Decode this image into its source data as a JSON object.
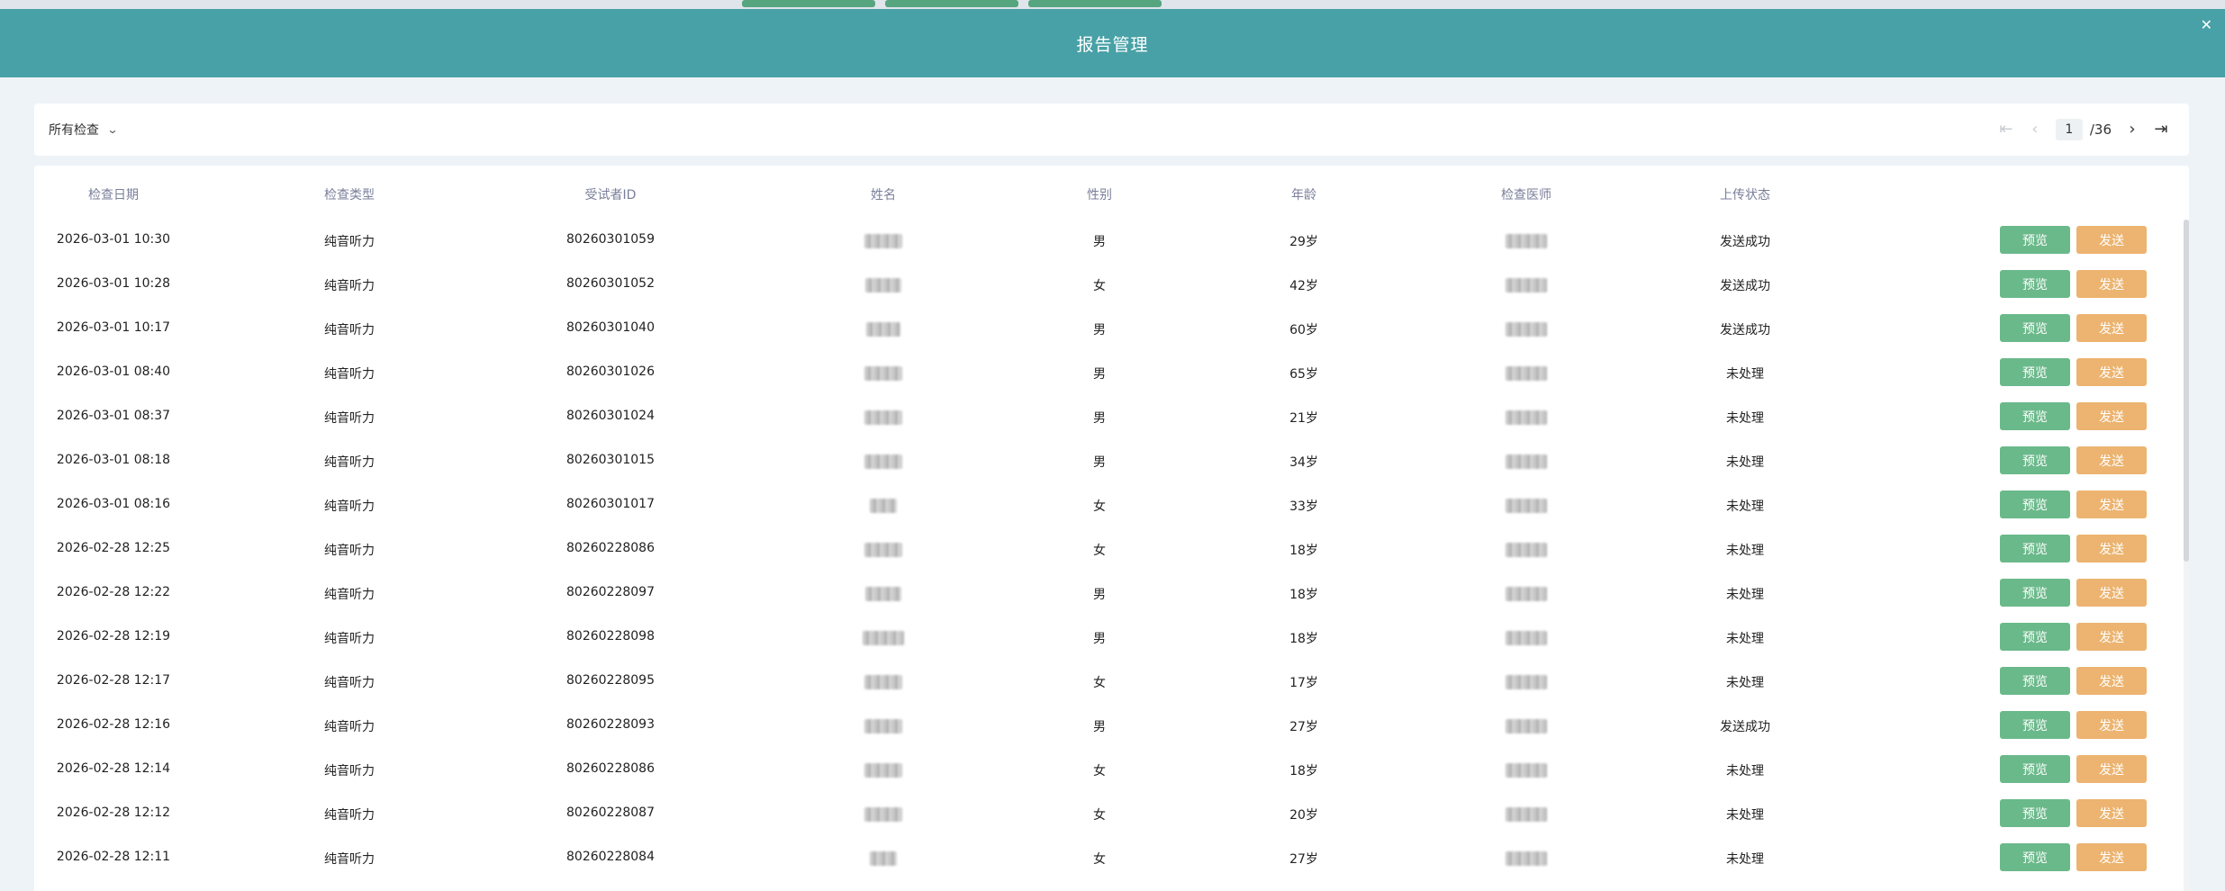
{
  "dialog": {
    "title": "报告管理"
  },
  "toolbar": {
    "filter_label": "所有检查",
    "pager": {
      "current": "1",
      "total": "/36"
    }
  },
  "table": {
    "headers": [
      "检查日期",
      "检查类型",
      "受试者ID",
      "姓名",
      "性别",
      "年龄",
      "检查医师",
      "上传状态"
    ],
    "action_labels": {
      "preview": "预览",
      "send": "发送"
    },
    "rows": [
      {
        "date": "2026-03-01 10:30",
        "type": "纯音听力",
        "id": "80260301059",
        "gender": "男",
        "age": "29岁",
        "status": "发送成功"
      },
      {
        "date": "2026-03-01 10:28",
        "type": "纯音听力",
        "id": "80260301052",
        "gender": "女",
        "age": "42岁",
        "status": "发送成功"
      },
      {
        "date": "2026-03-01 10:17",
        "type": "纯音听力",
        "id": "80260301040",
        "gender": "男",
        "age": "60岁",
        "status": "发送成功"
      },
      {
        "date": "2026-03-01 08:40",
        "type": "纯音听力",
        "id": "80260301026",
        "gender": "男",
        "age": "65岁",
        "status": "未处理"
      },
      {
        "date": "2026-03-01 08:37",
        "type": "纯音听力",
        "id": "80260301024",
        "gender": "男",
        "age": "21岁",
        "status": "未处理"
      },
      {
        "date": "2026-03-01 08:18",
        "type": "纯音听力",
        "id": "80260301015",
        "gender": "男",
        "age": "34岁",
        "status": "未处理"
      },
      {
        "date": "2026-03-01 08:16",
        "type": "纯音听力",
        "id": "80260301017",
        "gender": "女",
        "age": "33岁",
        "status": "未处理"
      },
      {
        "date": "2026-02-28 12:25",
        "type": "纯音听力",
        "id": "80260228086",
        "gender": "女",
        "age": "18岁",
        "status": "未处理"
      },
      {
        "date": "2026-02-28 12:22",
        "type": "纯音听力",
        "id": "80260228097",
        "gender": "男",
        "age": "18岁",
        "status": "未处理"
      },
      {
        "date": "2026-02-28 12:19",
        "type": "纯音听力",
        "id": "80260228098",
        "gender": "男",
        "age": "18岁",
        "status": "未处理"
      },
      {
        "date": "2026-02-28 12:17",
        "type": "纯音听力",
        "id": "80260228095",
        "gender": "女",
        "age": "17岁",
        "status": "未处理"
      },
      {
        "date": "2026-02-28 12:16",
        "type": "纯音听力",
        "id": "80260228093",
        "gender": "男",
        "age": "27岁",
        "status": "发送成功"
      },
      {
        "date": "2026-02-28 12:14",
        "type": "纯音听力",
        "id": "80260228086",
        "gender": "女",
        "age": "18岁",
        "status": "未处理"
      },
      {
        "date": "2026-02-28 12:12",
        "type": "纯音听力",
        "id": "80260228087",
        "gender": "女",
        "age": "20岁",
        "status": "未处理"
      },
      {
        "date": "2026-02-28 12:11",
        "type": "纯音听力",
        "id": "80260228084",
        "gender": "女",
        "age": "27岁",
        "status": "未处理"
      }
    ]
  },
  "colors": {
    "header_bg": "#48a1a6",
    "preview_button": "#6ab98a",
    "send_button": "#ecb470",
    "page_bg": "#eef3f8"
  }
}
